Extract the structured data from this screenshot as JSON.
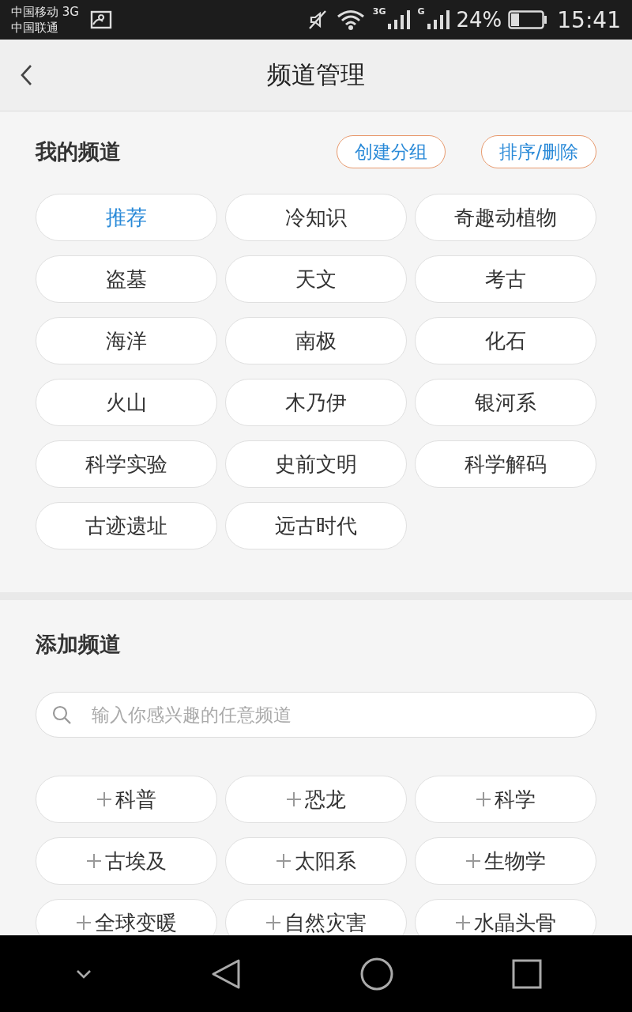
{
  "status_bar": {
    "carrier_1": "中国移动 3G",
    "carrier_2": "中国联通",
    "network_1": "3G",
    "network_2": "G",
    "battery": "24%",
    "time": "15:41"
  },
  "header": {
    "title": "频道管理"
  },
  "my_channels": {
    "title": "我的频道",
    "actions": [
      "创建分组",
      "排序/删除"
    ],
    "channels": [
      {
        "label": "推荐",
        "selected": true
      },
      {
        "label": "冷知识",
        "selected": false
      },
      {
        "label": "奇趣动植物",
        "selected": false
      },
      {
        "label": "盗墓",
        "selected": false
      },
      {
        "label": "天文",
        "selected": false
      },
      {
        "label": "考古",
        "selected": false
      },
      {
        "label": "海洋",
        "selected": false
      },
      {
        "label": "南极",
        "selected": false
      },
      {
        "label": "化石",
        "selected": false
      },
      {
        "label": "火山",
        "selected": false
      },
      {
        "label": "木乃伊",
        "selected": false
      },
      {
        "label": "银河系",
        "selected": false
      },
      {
        "label": "科学实验",
        "selected": false
      },
      {
        "label": "史前文明",
        "selected": false
      },
      {
        "label": "科学解码",
        "selected": false
      },
      {
        "label": "古迹遗址",
        "selected": false
      },
      {
        "label": "远古时代",
        "selected": false
      }
    ]
  },
  "add_channels": {
    "title": "添加频道",
    "search": {
      "placeholder": "输入你感兴趣的任意频道"
    },
    "channels": [
      "科普",
      "恐龙",
      "科学",
      "古埃及",
      "太阳系",
      "生物学",
      "全球变暖",
      "自然灾害",
      "水晶头骨"
    ]
  }
}
